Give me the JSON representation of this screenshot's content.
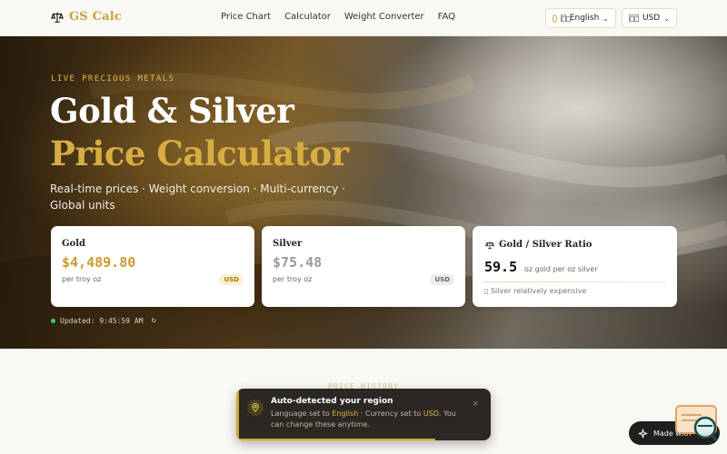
{
  "nav": {
    "logo_text": "GS Calc",
    "links": [
      "Price Chart",
      "Calculator",
      "Weight Converter",
      "FAQ"
    ],
    "language": "English",
    "currency": "USD"
  },
  "hero": {
    "eyebrow": "LIVE PRECIOUS METALS",
    "title_line1": "Gold & Silver",
    "title_line2": "Price Calculator",
    "subtitle": "Real-time prices · Weight conversion · Multi-currency · Global units",
    "updated": "Updated: 9:45:59 AM"
  },
  "cards": {
    "gold": {
      "title": "Gold",
      "price": "$4,489.80",
      "unit": "per troy oz",
      "badge": "USD"
    },
    "silver": {
      "title": "Silver",
      "price": "$75.48",
      "unit": "per troy oz",
      "badge": "USD"
    },
    "ratio": {
      "title": "Gold / Silver Ratio",
      "value": "59.5",
      "desc": "oz gold per oz silver",
      "note": "Silver relatively expensive"
    }
  },
  "section": {
    "label": "PRICE HISTORY"
  },
  "toast": {
    "title": "Auto-detected your region",
    "body_prefix": "Language set to ",
    "language": "English",
    "body_middle": " · Currency set to ",
    "currency": "USD",
    "body_suffix": ". You can change these anytime.",
    "close": "×",
    "progress": 0.78
  },
  "made_with": {
    "label": "Made with"
  },
  "colors": {
    "gold_accent": "#d8ad43",
    "dark": "#2b2722",
    "status_green": "#3ecf6a"
  }
}
